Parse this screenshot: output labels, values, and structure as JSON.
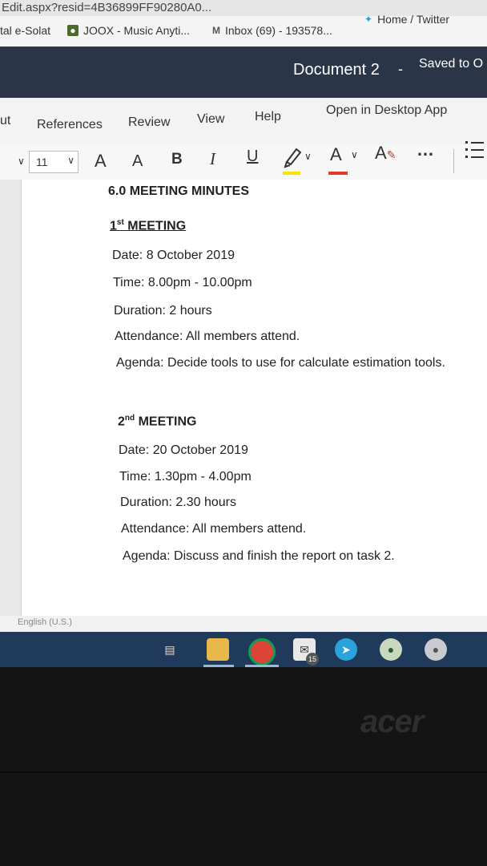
{
  "browser": {
    "url": "Edit.aspx?resid=4B36899FF90280A0...",
    "bookmarks": [
      {
        "label": "tal e-Solat",
        "icon": ""
      },
      {
        "label": "JOOX - Music Anyti...",
        "icon": "joox-icon"
      },
      {
        "label": "Inbox (69) - 193578...",
        "icon": "gmail-icon"
      },
      {
        "label": "Home / Twitter",
        "icon": "twitter-icon"
      }
    ]
  },
  "app": {
    "doc_title": "Document 2",
    "separator": "-",
    "saved": "Saved to O"
  },
  "menu": [
    "ut",
    "References",
    "Review",
    "View",
    "Help",
    "Open in Desktop App"
  ],
  "toolbar": {
    "font_size": "11",
    "grow": "A",
    "shrink": "A",
    "bold": "B",
    "italic": "I",
    "underline": "U",
    "font_color": "A",
    "more": "…",
    "highlight_color": "#f5e500",
    "font_color_hex": "#e03a2a"
  },
  "document": {
    "heading": "6.0 MEETING MINUTES",
    "meetings": [
      {
        "ordinal_num": "1",
        "ordinal_sup": "st",
        "title": " MEETING",
        "date": "Date: 8 October 2019",
        "time": "Time: 8.00pm - 10.00pm",
        "duration": "Duration: 2 hours",
        "attendance": "Attendance: All members attend.",
        "agenda": "Agenda: Decide tools to use for calculate estimation tools."
      },
      {
        "ordinal_num": "2",
        "ordinal_sup": "nd",
        "title": " MEETING",
        "date": "Date: 20 October 2019",
        "time": "Time: 1.30pm - 4.00pm",
        "duration": "Duration: 2.30 hours",
        "attendance": "Attendance: All members attend.",
        "agenda": "Agenda: Discuss and finish the report on task 2."
      }
    ]
  },
  "status": {
    "language": "English (U.S.)"
  },
  "taskbar": {
    "mail_badge": "15"
  },
  "laptop": {
    "brand": "acer"
  }
}
